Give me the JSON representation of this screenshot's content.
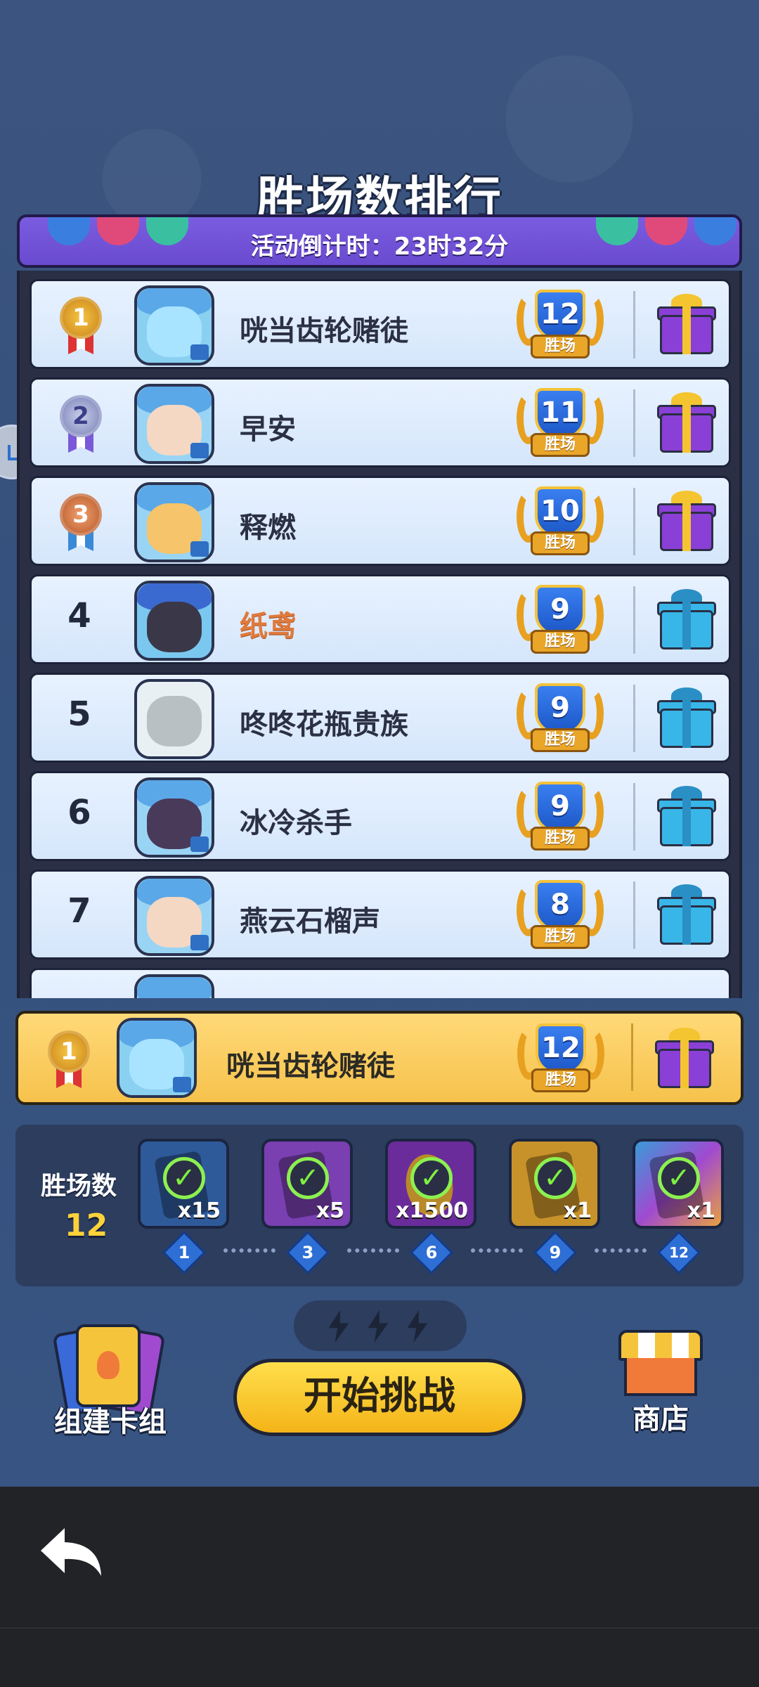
{
  "title": "胜场数排行",
  "banner": {
    "countdown": "活动倒计时：23时32分"
  },
  "wins_label": "胜场",
  "leaderboard": [
    {
      "rank": "1",
      "name": "咣当齿轮赌徒",
      "wins": "12",
      "gift": "purple",
      "medal": "gold"
    },
    {
      "rank": "2",
      "name": "早安",
      "wins": "11",
      "gift": "purple",
      "medal": "silver"
    },
    {
      "rank": "3",
      "name": "释燃",
      "wins": "10",
      "gift": "purple",
      "medal": "bronze"
    },
    {
      "rank": "4",
      "name": "纸鸢",
      "wins": "9",
      "gift": "cyan",
      "medal": null
    },
    {
      "rank": "5",
      "name": "咚咚花瓶贵族",
      "wins": "9",
      "gift": "cyan",
      "medal": null
    },
    {
      "rank": "6",
      "name": "冰冷杀手",
      "wins": "9",
      "gift": "cyan",
      "medal": null
    },
    {
      "rank": "7",
      "name": "燕云石榴声",
      "wins": "8",
      "gift": "cyan",
      "medal": null
    }
  ],
  "my_entry": {
    "rank": "1",
    "name": "咣当齿轮赌徒",
    "wins": "12"
  },
  "progress": {
    "label": "胜场数",
    "value": "12",
    "rewards": [
      {
        "qty": "x15",
        "color": "#2f5a9a"
      },
      {
        "qty": "x5",
        "color": "#7a3fb0"
      },
      {
        "qty": "x1500",
        "color": "#6a2c9a"
      },
      {
        "qty": "x1",
        "color": "#c8922a"
      },
      {
        "qty": "x1",
        "color": "#4a78b8"
      }
    ],
    "milestones": [
      "1",
      "3",
      "6",
      "9",
      "12"
    ]
  },
  "actions": {
    "deck_label": "组建卡组",
    "start_label": "开始挑战",
    "shop_label": "商店"
  },
  "icons": [
    "medal-icon",
    "gift-icon",
    "laurel-shield-icon",
    "check-icon",
    "bolt-icon",
    "shop-icon",
    "deck-icon",
    "back-arrow-icon"
  ]
}
